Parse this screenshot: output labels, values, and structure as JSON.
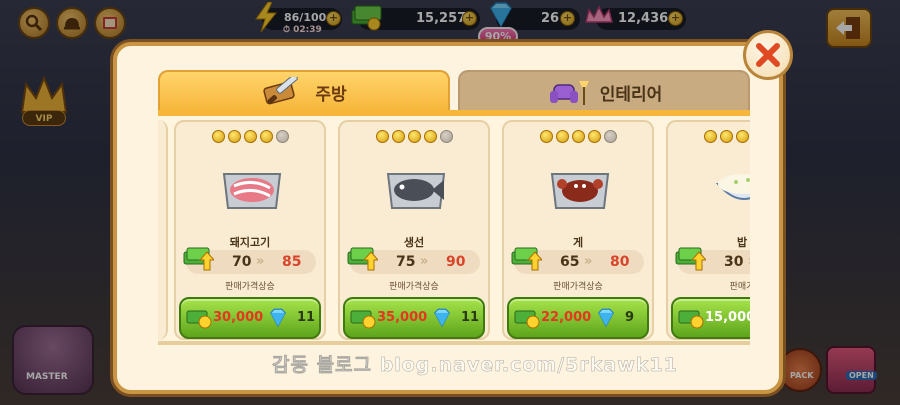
{
  "hud": {
    "energy": "86/100",
    "energy_timer": "02:39",
    "cash": "15,257",
    "gems": "26",
    "gem_bonus": "90%",
    "crowns": "12,436"
  },
  "side": {
    "vip_label": "VIP",
    "master_label": "MASTER",
    "pack_label": "PACK",
    "open_label": "OPEN"
  },
  "tabs": [
    {
      "label": "주방",
      "active": true
    },
    {
      "label": "인테리어",
      "active": false
    }
  ],
  "items": [
    {
      "name": "돼지고기",
      "stars": 4,
      "max_stars": 5,
      "price_from": "70",
      "price_to": "85",
      "caption": "판매가격상승",
      "cost": "30,000",
      "gem_cost": "11"
    },
    {
      "name": "생선",
      "stars": 4,
      "max_stars": 5,
      "price_from": "75",
      "price_to": "90",
      "caption": "판매가격상승",
      "cost": "35,000",
      "gem_cost": "11"
    },
    {
      "name": "게",
      "stars": 4,
      "max_stars": 5,
      "price_from": "65",
      "price_to": "80",
      "caption": "판매가격상승",
      "cost": "22,000",
      "gem_cost": "9"
    },
    {
      "name": "밥",
      "stars": 4,
      "max_stars": 5,
      "price_from": "30",
      "price_to": "",
      "caption": "판매가",
      "cost": "15,000",
      "gem_cost": ""
    }
  ],
  "watermark": "감동 블로그 blog.naver.com/5rkawk11",
  "colors": {
    "tab_active": "#f6b63a",
    "buy_button": "#5ea51c",
    "price_new": "#d8452a",
    "modal_border": "#c99443"
  }
}
